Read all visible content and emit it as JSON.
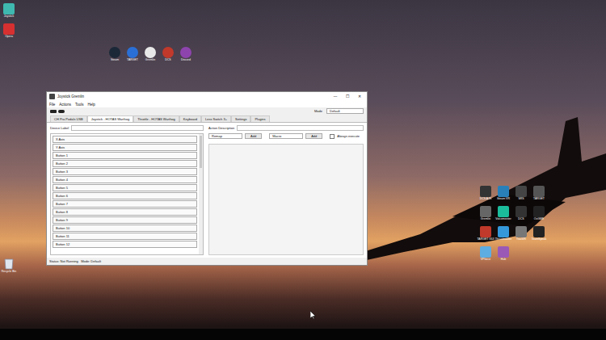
{
  "desktop": {
    "left_icons": [
      "Joystick",
      "Opera"
    ],
    "top_icons": [
      "Steam",
      "TARGET",
      "Gremlin",
      "DCS",
      "Discord"
    ],
    "right_icons": [
      "DCS AJS",
      "Steam VR",
      "SRS",
      "TARGET",
      "Gremlin",
      "Voicemeeter",
      "DCS",
      "OvGME",
      "TARGET GUI",
      "Thrustmaster",
      "TrackIR",
      "TeamSpeak",
      "VPforce",
      "Hub"
    ],
    "recycle_bin": "Recycle Bin"
  },
  "window": {
    "title": "Joystick Gremlin",
    "controls": [
      "—",
      "☐",
      "✕"
    ],
    "menu": [
      "File",
      "Actions",
      "Tools",
      "Help"
    ],
    "mode": {
      "label": "Mode",
      "value": "Default"
    },
    "tabs": [
      {
        "label": "CH Pro Pedals USB",
        "selected": false
      },
      {
        "label": "Joystick - HOTAS Warthog",
        "selected": true
      },
      {
        "label": "Throttle - HOTAS Warthog",
        "selected": false
      },
      {
        "label": "Keyboard",
        "selected": false
      },
      {
        "label": "Less Switch 3+",
        "selected": false
      },
      {
        "label": "Settings",
        "selected": false
      },
      {
        "label": "Plugins",
        "selected": false
      }
    ],
    "device_label": "Device Label",
    "inputs": [
      "X Axis",
      "Y Axis",
      "Button 1",
      "Button 2",
      "Button 3",
      "Button 4",
      "Button 5",
      "Button 6",
      "Button 7",
      "Button 8",
      "Button 9",
      "Button 10",
      "Button 11",
      "Button 12"
    ],
    "action_description": "Action Description",
    "action_pickers": [
      {
        "value": "Remap",
        "button": "Add"
      },
      {
        "value": "Macro",
        "button": "Add"
      }
    ],
    "always_execute": {
      "label": "Always execute",
      "checked": false
    },
    "status": "Status: Not Running   Mode: Default"
  }
}
